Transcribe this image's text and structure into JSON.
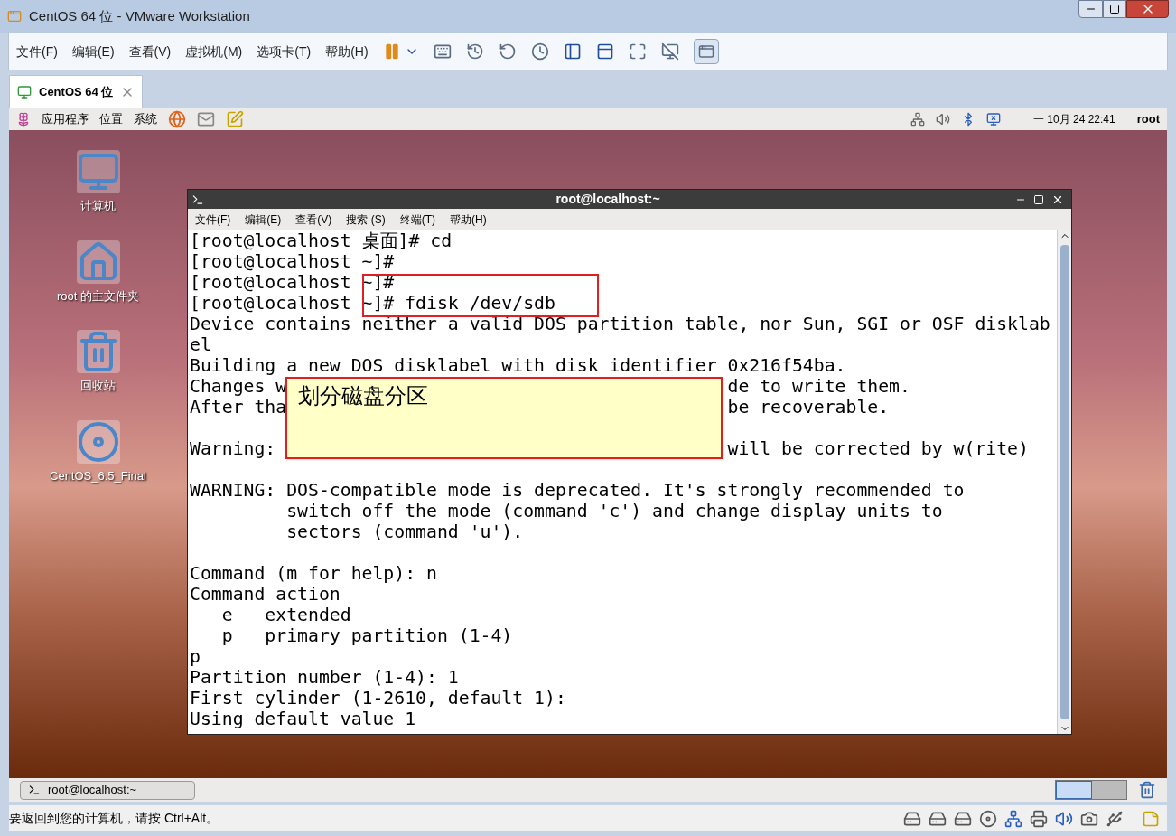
{
  "window": {
    "title": "CentOS 64 位 - VMware Workstation"
  },
  "menu": [
    "文件(F)",
    "编辑(E)",
    "查看(V)",
    "虚拟机(M)",
    "选项卡(T)",
    "帮助(H)"
  ],
  "tabs": [
    {
      "label": "CentOS 64 位",
      "selected": true
    }
  ],
  "guest_panel": {
    "menus": [
      "应用程序",
      "位置",
      "系统"
    ],
    "clock": "一 10月 24 22:41",
    "user": "root"
  },
  "desktop_icons": [
    {
      "label": "计算机",
      "kind": "computer"
    },
    {
      "label": "root 的主文件夹",
      "kind": "home"
    },
    {
      "label": "回收站",
      "kind": "trash"
    },
    {
      "label": "CentOS_6.5_Final",
      "kind": "dvd"
    }
  ],
  "terminal": {
    "title": "root@localhost:~",
    "menu": [
      "文件(F)",
      "编辑(E)",
      "查看(V)",
      "搜索 (S)",
      "终端(T)",
      "帮助(H)"
    ],
    "lines": [
      {
        "text": "[root@localhost 桌面]# cd"
      },
      {
        "text": "[root@localhost ~]#"
      },
      {
        "text": "[root@localhost ~]#"
      },
      {
        "text": "[root@localhost ~]# fdisk /dev/sdb"
      },
      {
        "text": "Device contains neither a valid DOS partition table, nor Sun, SGI or OSF disklab"
      },
      {
        "text": "el"
      },
      {
        "text": "Building a new DOS disklabel with disk identifier 0x216f54ba."
      },
      {
        "text": "Changes w",
        "after": "de to write them."
      },
      {
        "text": "After tha",
        "after": "be recoverable."
      },
      {
        "text": "Warning: ",
        "after": "will be corrected by w(rite)",
        "blank_before": true
      },
      {
        "text": "WARNING: DOS-compatible mode is deprecated. It's strongly recommended to",
        "blank_before": true
      },
      {
        "text": "         switch off the mode (command 'c') and change display units to"
      },
      {
        "text": "         sectors (command 'u')."
      },
      {
        "text": "Command (m for help): n",
        "blank_before": true
      },
      {
        "text": "Command action"
      },
      {
        "text": "   e   extended"
      },
      {
        "text": "   p   primary partition (1-4)"
      },
      {
        "text": "p"
      },
      {
        "text": "Partition number (1-4): 1"
      },
      {
        "text": "First cylinder (1-2610, default 1):"
      },
      {
        "text": "Using default value 1"
      }
    ]
  },
  "note": {
    "text": "划分磁盘分区"
  },
  "taskbar": {
    "items": [
      {
        "label": "root@localhost:~",
        "selected": false
      }
    ]
  },
  "status_bar": {
    "text": "要返回到您的计算机，请按 Ctrl+Alt。"
  }
}
